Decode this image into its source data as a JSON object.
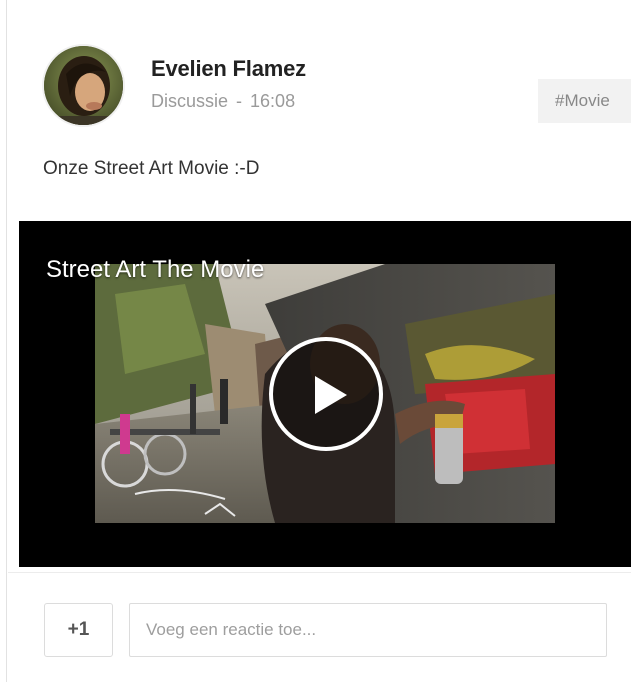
{
  "post": {
    "author": "Evelien Flamez",
    "type": "Discussie",
    "separator": "-",
    "time": "16:08",
    "tag": "#Movie",
    "text": "Onze Street Art Movie :-D",
    "video": {
      "title": "Street Art The Movie",
      "play_icon": "play-icon"
    }
  },
  "actions": {
    "plus_one_label": "+1",
    "comment_placeholder": "Voeg een reactie toe..."
  },
  "colors": {
    "divider": "#ececec",
    "meta_text": "#9a9a9a",
    "tag_background": "#f2f2f2",
    "video_background": "#000000"
  }
}
